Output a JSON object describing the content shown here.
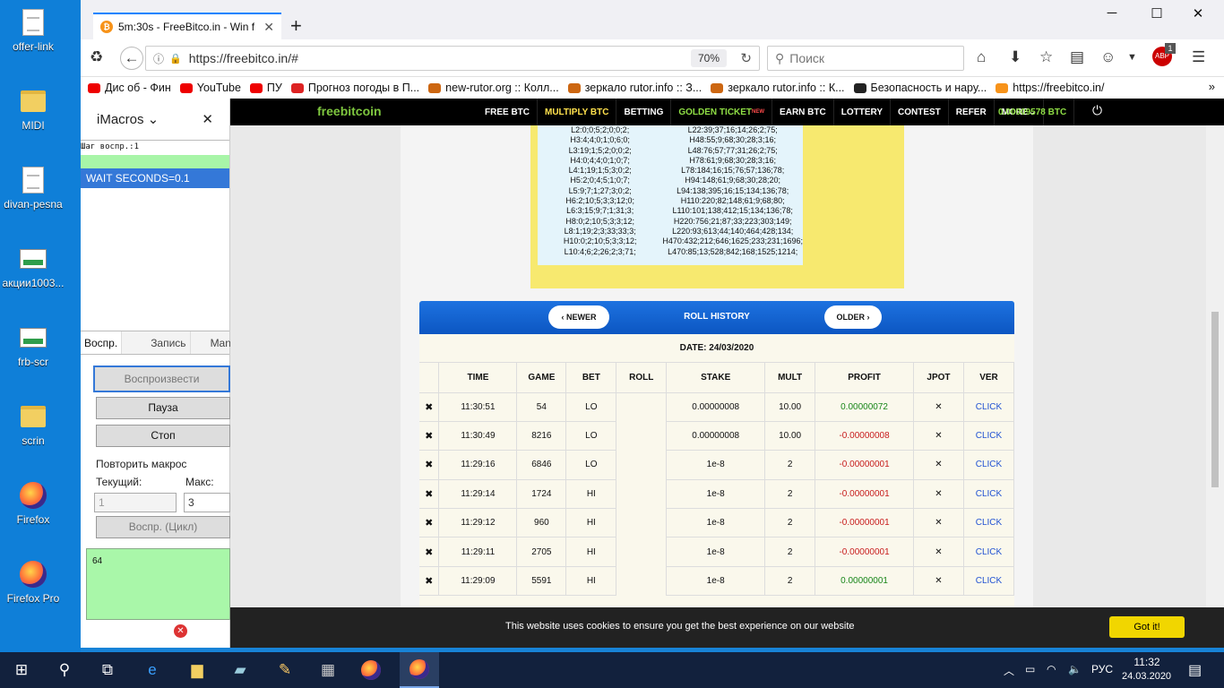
{
  "desktop": {
    "icons": [
      {
        "label": "offer-link",
        "icon": "file-icon"
      },
      {
        "label": "MIDI",
        "icon": "folder-icon"
      },
      {
        "label": "divan-pesna",
        "icon": "file-icon"
      },
      {
        "label": "акции1003...",
        "icon": "image-icon"
      },
      {
        "label": "frb-scr",
        "icon": "image-icon"
      },
      {
        "label": "scrin",
        "icon": "folder-icon"
      },
      {
        "label": "Firefox",
        "icon": "firefox-icon"
      },
      {
        "label": "Firefox Pro",
        "icon": "firefox-icon"
      }
    ],
    "partial_labels": [
      "sa",
      "na"
    ]
  },
  "browser": {
    "tab_title": "5m:30s - FreeBitco.in - Win f",
    "url": "https://freebitco.in/#",
    "zoom": "70%",
    "search_placeholder": "Поиск",
    "addon_badge": "1",
    "addon_label": "ABP",
    "bookmarks": [
      {
        "label": "Дис об - Фин",
        "color": "#e00"
      },
      {
        "label": "YouTube",
        "color": "#e00"
      },
      {
        "label": "ПУ",
        "color": "#e00"
      },
      {
        "label": "Прогноз погоды в П...",
        "color": "#d22"
      },
      {
        "label": "new-rutor.org :: Колл...",
        "color": "#c61"
      },
      {
        "label": "зеркало rutor.info :: З...",
        "color": "#c61"
      },
      {
        "label": "зеркало rutor.info :: К...",
        "color": "#c61"
      },
      {
        "label": "Безопасность и нару...",
        "color": "#222"
      },
      {
        "label": "https://freebitco.in/",
        "color": "#f7931a"
      }
    ]
  },
  "imacros": {
    "title": "iMacros",
    "log_line": "Шаг воспр.:1",
    "current_command": "WAIT SECONDS=0.1",
    "tabs": [
      "Воспр.",
      "Запись",
      "Mana"
    ],
    "play_button": "Воспроизвести",
    "pause_button": "Пауза",
    "stop_button": "Стоп",
    "repeat_label": "Повторить макрос",
    "current_label": "Текущий:",
    "max_label": "Макс:",
    "current_value": "1",
    "max_value": "3",
    "loop_button": "Воспр. (Цикл)",
    "output": "64"
  },
  "site": {
    "logo_a": "free",
    "logo_b": "bitcoin",
    "menu": [
      {
        "label": "FREE BTC",
        "style": ""
      },
      {
        "label": "MULTIPLY BTC",
        "style": "y"
      },
      {
        "label": "BETTING",
        "style": ""
      },
      {
        "label": "GOLDEN TICKET",
        "style": "g",
        "sup": "NEW"
      },
      {
        "label": "EARN BTC",
        "style": ""
      },
      {
        "label": "LOTTERY",
        "style": ""
      },
      {
        "label": "CONTEST",
        "style": ""
      },
      {
        "label": "REFER",
        "style": ""
      },
      {
        "label": "MORE",
        "style": ""
      }
    ],
    "balance": "0.00009578 BTC",
    "stats_left": [
      "L2:0;0;5;2;0;0;2;",
      "H3:4;4;0;1;0;6;0;",
      "L3:19;1;5;2;0;0;2;",
      "H4:0;4;4;0;1;0;7;",
      "L4:1;19;1;5;3;0;2;",
      "H5:2;0;4;5;1;0;7;",
      "L5:9;7;1;27;3;0;2;",
      "H6:2;10;5;3;3;12;0;",
      "L6:3;15;9;7;1;31;3;",
      "H8:0;2;10;5;3;3;12;",
      "L8:1;19;2;3;33;33;3;",
      "H10:0;2;10;5;3;3;12;",
      "L10:4;6;2;26;2;3;71;"
    ],
    "stats_right": [
      "L22:39;37;16;14;26;2;75;",
      "H48:55;9;68;30;28;3;16;",
      "L48:76;57;77;31;26;2;75;",
      "H78:61;9;68;30;28;3;16;",
      "L78:184;16;15;76;57;136;78;",
      "H94:148;61;9;68;30;28;20;",
      "L94:138;395;16;15;134;136;78;",
      "H110:220;82;148;61;9;68;80;",
      "L110:101;138;412;15;134;136;78;",
      "H220:756;21;87;33;223;303;149;",
      "L220:93;613;44;140;464;428;134;",
      "H470:432;212;646;1625;233;231;1696;",
      "L470:85;13;528;842;168;1525;1214;"
    ],
    "roll_history": {
      "newer": "NEWER",
      "older": "OLDER",
      "title": "ROLL HISTORY",
      "date": "DATE: 24/03/2020",
      "columns": [
        "",
        "TIME",
        "GAME",
        "BET",
        "ROLL",
        "STAKE",
        "MULT",
        "PROFIT",
        "JPOT",
        "VER"
      ],
      "rows": [
        {
          "time": "11:30:51",
          "game": "54",
          "bet": "LO",
          "roll": "",
          "stake": "0.00000008",
          "mult": "10.00",
          "profit": "0.00000072",
          "sign": "pos",
          "jpot": "✕",
          "ver": "CLICK"
        },
        {
          "time": "11:30:49",
          "game": "8216",
          "bet": "LO",
          "roll": "",
          "stake": "0.00000008",
          "mult": "10.00",
          "profit": "-0.00000008",
          "sign": "neg",
          "jpot": "✕",
          "ver": "CLICK"
        },
        {
          "time": "11:29:16",
          "game": "6846",
          "bet": "LO",
          "roll": "",
          "stake": "1e-8",
          "mult": "2",
          "profit": "-0.00000001",
          "sign": "neg",
          "jpot": "✕",
          "ver": "CLICK"
        },
        {
          "time": "11:29:14",
          "game": "1724",
          "bet": "HI",
          "roll": "",
          "stake": "1e-8",
          "mult": "2",
          "profit": "-0.00000001",
          "sign": "neg",
          "jpot": "✕",
          "ver": "CLICK"
        },
        {
          "time": "11:29:12",
          "game": "960",
          "bet": "HI",
          "roll": "",
          "stake": "1e-8",
          "mult": "2",
          "profit": "-0.00000001",
          "sign": "neg",
          "jpot": "✕",
          "ver": "CLICK"
        },
        {
          "time": "11:29:11",
          "game": "2705",
          "bet": "HI",
          "roll": "",
          "stake": "1e-8",
          "mult": "2",
          "profit": "-0.00000001",
          "sign": "neg",
          "jpot": "✕",
          "ver": "CLICK"
        },
        {
          "time": "11:29:09",
          "game": "5591",
          "bet": "HI",
          "roll": "",
          "stake": "1e-8",
          "mult": "2",
          "profit": "0.00000001",
          "sign": "pos",
          "jpot": "✕",
          "ver": "CLICK"
        }
      ]
    },
    "cookie_text": "This website uses cookies to ensure you get the best experience on our website",
    "cookie_button": "Got it!"
  },
  "taskbar": {
    "language": "РУС",
    "time": "11:32",
    "date": "24.03.2020"
  }
}
